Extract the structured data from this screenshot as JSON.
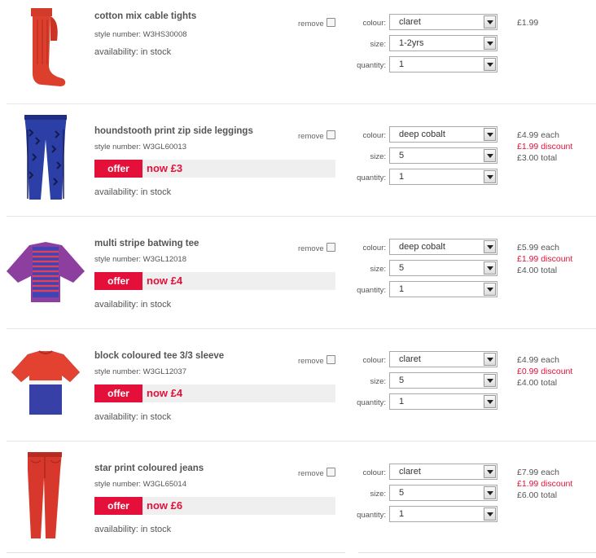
{
  "labels": {
    "remove": "remove",
    "colour": "colour:",
    "size": "size:",
    "quantity": "quantity:",
    "offer": "offer"
  },
  "items": [
    {
      "name": "cotton mix cable tights",
      "style_number": "style number: W3HS30008",
      "availability": "availability: in stock",
      "offer_text": null,
      "colour": "claret",
      "size": "1-2yrs",
      "quantity": "1",
      "price_each": "£1.99",
      "discount": null,
      "total": null,
      "image": "red-tights-image"
    },
    {
      "name": "houndstooth print zip side leggings",
      "style_number": "style number: W3GL60013",
      "availability": "availability: in stock",
      "offer_text": "now £3",
      "colour": "deep cobalt",
      "size": "5",
      "quantity": "1",
      "price_each": "£4.99 each",
      "discount": "£1.99 discount",
      "total": "£3.00 total",
      "image": "blue-leggings-image"
    },
    {
      "name": "multi stripe batwing tee",
      "style_number": "style number: W3GL12018",
      "availability": "availability: in stock",
      "offer_text": "now £4",
      "colour": "deep cobalt",
      "size": "5",
      "quantity": "1",
      "price_each": "£5.99 each",
      "discount": "£1.99 discount",
      "total": "£4.00 total",
      "image": "purple-batwing-tee-image"
    },
    {
      "name": "block coloured tee 3/3 sleeve",
      "style_number": "style number: W3GL12037",
      "availability": "availability: in stock",
      "offer_text": "now £4",
      "colour": "claret",
      "size": "5",
      "quantity": "1",
      "price_each": "£4.99 each",
      "discount": "£0.99 discount",
      "total": "£4.00 total",
      "image": "block-colour-tee-image"
    },
    {
      "name": "star print coloured jeans",
      "style_number": "style number: W3GL65014",
      "availability": "availability: in stock",
      "offer_text": "now £6",
      "colour": "claret",
      "size": "5",
      "quantity": "1",
      "price_each": "£7.99 each",
      "discount": "£1.99 discount",
      "total": "£6.00 total",
      "image": "red-jeans-image"
    }
  ],
  "colors": {
    "accent": "#e5103a",
    "offer_bg": "#efefef"
  }
}
